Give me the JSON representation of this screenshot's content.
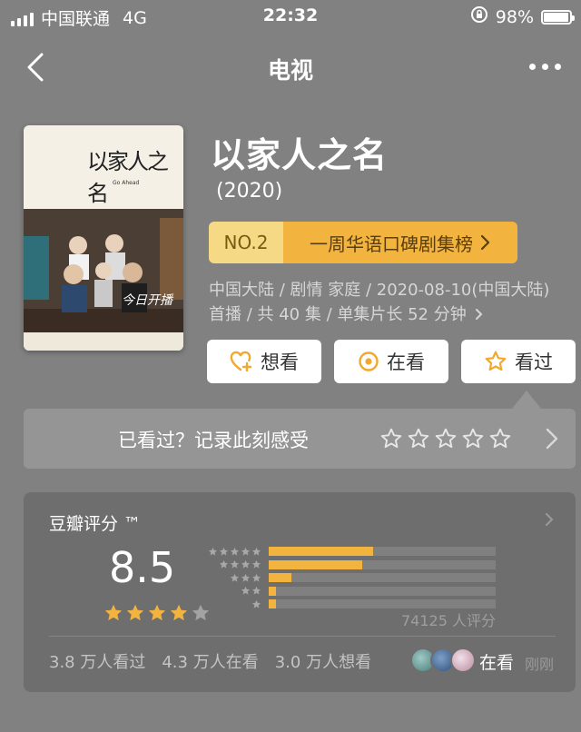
{
  "status_bar": {
    "carrier": "中国联通",
    "network": "4G",
    "time": "22:32",
    "battery_percent": "98%",
    "battery_level": 0.98,
    "icons": [
      "signal-icon",
      "rotation-lock-icon",
      "battery-icon"
    ]
  },
  "nav": {
    "title": "电视",
    "back_icon": "chevron-left-icon",
    "more_icon": "more-dots-icon"
  },
  "poster": {
    "title_text": "以家人之名",
    "en_text": "Go Ahead",
    "tag_text": "今日开播"
  },
  "show": {
    "title": "以家人之名",
    "year": "(2020)"
  },
  "rank": {
    "no": "NO.2",
    "label": "一周华语口碑剧集榜",
    "colors": {
      "left": "#f6d984",
      "right": "#f3b43f"
    }
  },
  "meta": {
    "text": "中国大陆 / 剧情 家庭 / 2020-08-10(中国大陆) 首播 / 共 40 集 / 单集片长 52 分钟"
  },
  "actions": [
    {
      "label": "想看",
      "icon": "heart-plus-icon"
    },
    {
      "label": "在看",
      "icon": "target-icon"
    },
    {
      "label": "看过",
      "icon": "star-outline-icon"
    }
  ],
  "record": {
    "label": "已看过？记录此刻感受",
    "stars": 5
  },
  "rating": {
    "label": "豆瓣评分 ™",
    "score": "8.5",
    "stars_filled": 4,
    "distribution": [
      {
        "stars": 5,
        "fraction": 0.46
      },
      {
        "stars": 4,
        "fraction": 0.41
      },
      {
        "stars": 3,
        "fraction": 0.1
      },
      {
        "stars": 2,
        "fraction": 0.02
      },
      {
        "stars": 1,
        "fraction": 0.01
      }
    ],
    "count": "74125 人评分",
    "stats": [
      "3.8 万人看过",
      "4.3 万人在看",
      "3.0 万人想看"
    ],
    "friend_status": "在看",
    "friend_time": "刚刚",
    "accent": "#f3b43f"
  }
}
